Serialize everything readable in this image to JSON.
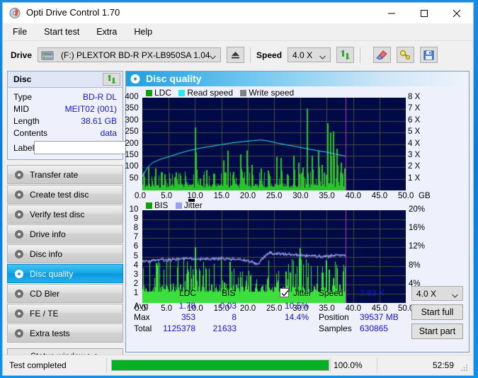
{
  "window": {
    "title": "Opti Drive Control 1.70",
    "icon": "disc-icon",
    "minimize": "—",
    "maximize": "□",
    "close": "✕"
  },
  "menu": {
    "items": [
      {
        "label": "File"
      },
      {
        "label": "Start test"
      },
      {
        "label": "Extra"
      },
      {
        "label": "Help"
      }
    ]
  },
  "toolbar": {
    "drive_label": "Drive",
    "drive_value": "(F:)  PLEXTOR BD-R  PX-LB950SA 1.04",
    "eject_icon": "eject-icon",
    "speed_label": "Speed",
    "speed_value": "4.0 X",
    "refresh_icon": "refresh-icon",
    "eraser_icon": "eraser-icon",
    "tools_icon": "tools-icon",
    "save_icon": "save-icon"
  },
  "sidebar": {
    "disc_panel": {
      "title": "Disc",
      "refresh_icon": "refresh-icon",
      "rows": [
        {
          "key": "Type",
          "value": "BD-R DL"
        },
        {
          "key": "MID",
          "value": "MEIT02 (001)"
        },
        {
          "key": "Length",
          "value": "38.61 GB"
        },
        {
          "key": "Contents",
          "value": "data"
        }
      ],
      "label_key": "Label",
      "label_value": "",
      "label_placeholder": "",
      "disc_icon": "cd-icon"
    },
    "nav": [
      {
        "label": "Transfer rate",
        "icon": "disc-icon",
        "active": false
      },
      {
        "label": "Create test disc",
        "icon": "disc-write-icon",
        "active": false
      },
      {
        "label": "Verify test disc",
        "icon": "disc-verify-icon",
        "active": false
      },
      {
        "label": "Drive info",
        "icon": "disc-info-icon",
        "active": false
      },
      {
        "label": "Disc info",
        "icon": "disc-info-icon",
        "active": false
      },
      {
        "label": "Disc quality",
        "icon": "disc-quality-icon",
        "active": true
      },
      {
        "label": "CD Bler",
        "icon": "disc-bler-icon",
        "active": false
      },
      {
        "label": "FE / TE",
        "icon": "disc-fete-icon",
        "active": false
      },
      {
        "label": "Extra tests",
        "icon": "disc-extra-icon",
        "active": false
      }
    ],
    "status_window_button": "Status window > >"
  },
  "panel": {
    "title": "Disc quality",
    "icon": "disc-quality-icon"
  },
  "chart_data": [
    {
      "id": "top-chart",
      "type": "line",
      "title": "LDC / Read speed",
      "legend": [
        {
          "label": "LDC",
          "color": "#07a407"
        },
        {
          "label": "Read speed",
          "color": "#2ee6f0"
        },
        {
          "label": "Write speed",
          "color": "#808080"
        }
      ],
      "xlabel": "GB",
      "x_ticks": [
        "0.0",
        "5.0",
        "10.0",
        "15.0",
        "20.0",
        "25.0",
        "30.0",
        "35.0",
        "40.0",
        "45.0",
        "50.0"
      ],
      "xlim": [
        0,
        50
      ],
      "ylabel_left": "LDC",
      "y_ticks_left": [
        "50",
        "100",
        "150",
        "200",
        "250",
        "300",
        "350",
        "400"
      ],
      "ylim_left": [
        0,
        400
      ],
      "ylabel_right": "Speed",
      "y_ticks_right": [
        "1 X",
        "2 X",
        "3 X",
        "4 X",
        "5 X",
        "6 X",
        "7 X",
        "8 X"
      ],
      "ylim_right": [
        0,
        8
      ],
      "data_end_gb": 38.61,
      "grid": true,
      "bg": "#000a46",
      "series": [
        {
          "name": "Read speed",
          "color": "#2ee6f0",
          "x": [
            0.0,
            1.0,
            2.0,
            3.5,
            5.0,
            7.0,
            9.0,
            11.0,
            13.0,
            15.0,
            17.0,
            19.0,
            21.0,
            22.5,
            23.5,
            24.3,
            25.0,
            26.0,
            27.5,
            29.0,
            31.0,
            33.0,
            35.0,
            36.5,
            38.0,
            38.61
          ],
          "y": [
            1.2,
            2.0,
            2.4,
            2.7,
            2.9,
            3.2,
            3.45,
            3.65,
            3.8,
            3.95,
            4.1,
            4.2,
            4.3,
            4.35,
            4.3,
            4.22,
            4.15,
            4.05,
            3.92,
            3.8,
            3.62,
            3.45,
            3.3,
            3.15,
            3.0,
            2.95
          ]
        },
        {
          "name": "LDC",
          "color": "#2bc32b",
          "note": "dense spike series, baseline ~20-40, major spikes listed",
          "baseline": 25,
          "spikes": [
            {
              "x": 1.1,
              "y": 100
            },
            {
              "x": 2.4,
              "y": 95
            },
            {
              "x": 4.2,
              "y": 70
            },
            {
              "x": 6.3,
              "y": 78
            },
            {
              "x": 8.0,
              "y": 62
            },
            {
              "x": 9.9,
              "y": 272
            },
            {
              "x": 10.1,
              "y": 150
            },
            {
              "x": 12.1,
              "y": 88
            },
            {
              "x": 13.6,
              "y": 72
            },
            {
              "x": 15.3,
              "y": 130
            },
            {
              "x": 16.1,
              "y": 172
            },
            {
              "x": 17.2,
              "y": 80
            },
            {
              "x": 18.6,
              "y": 155
            },
            {
              "x": 19.8,
              "y": 172
            },
            {
              "x": 20.7,
              "y": 110
            },
            {
              "x": 22.5,
              "y": 95
            },
            {
              "x": 23.8,
              "y": 86
            },
            {
              "x": 25.4,
              "y": 145
            },
            {
              "x": 26.2,
              "y": 140
            },
            {
              "x": 27.4,
              "y": 70
            },
            {
              "x": 28.6,
              "y": 150
            },
            {
              "x": 29.6,
              "y": 120
            },
            {
              "x": 30.4,
              "y": 98
            },
            {
              "x": 31.2,
              "y": 353
            },
            {
              "x": 32.1,
              "y": 150
            },
            {
              "x": 33.3,
              "y": 170
            },
            {
              "x": 34.0,
              "y": 110
            },
            {
              "x": 35.1,
              "y": 290
            },
            {
              "x": 35.6,
              "y": 250
            },
            {
              "x": 36.1,
              "y": 255
            },
            {
              "x": 36.8,
              "y": 180
            },
            {
              "x": 37.6,
              "y": 120
            },
            {
              "x": 38.3,
              "y": 95
            }
          ]
        }
      ]
    },
    {
      "id": "bottom-chart",
      "type": "line",
      "title": "BIS / Jitter",
      "legend": [
        {
          "label": "BIS",
          "color": "#07a407"
        },
        {
          "label": "Jitter",
          "color": "#9aa0ee"
        }
      ],
      "xlabel": "GB",
      "x_ticks": [
        "0.0",
        "5.0",
        "10.0",
        "15.0",
        "20.0",
        "25.0",
        "30.0",
        "35.0",
        "40.0",
        "45.0",
        "50.0"
      ],
      "xlim": [
        0,
        50
      ],
      "ylabel_left": "BIS",
      "y_ticks_left": [
        "1",
        "2",
        "3",
        "4",
        "5",
        "6",
        "7",
        "8",
        "9",
        "10"
      ],
      "ylim_left": [
        0,
        10
      ],
      "ylabel_right": "Jitter",
      "y_ticks_right": [
        "4%",
        "8%",
        "12%",
        "16%",
        "20%"
      ],
      "ylim_right": [
        0,
        20
      ],
      "data_end_gb": 38.61,
      "grid": true,
      "bg": "#000a46",
      "series": [
        {
          "name": "Jitter",
          "color": "#9aa0ee",
          "avg_pct": 10.5,
          "max_pct": 14.4,
          "x": [
            0.0,
            1.5,
            3.0,
            5.0,
            7.0,
            9.0,
            11.0,
            13.0,
            15.0,
            17.0,
            19.0,
            21.0,
            22.0,
            23.0,
            24.0,
            25.0,
            27.0,
            29.0,
            31.0,
            33.0,
            35.0,
            37.0,
            38.6
          ],
          "y": [
            9.2,
            9.0,
            9.4,
            9.3,
            9.5,
            9.6,
            9.4,
            9.5,
            9.6,
            9.4,
            9.3,
            8.8,
            8.4,
            9.8,
            10.9,
            10.6,
            10.5,
            10.4,
            10.2,
            10.1,
            10.0,
            10.4,
            10.3
          ]
        },
        {
          "name": "BIS",
          "color": "#2bc32b",
          "baseline": 1.0,
          "spikes": [
            {
              "x": 2.6,
              "y": 4.3
            },
            {
              "x": 5.2,
              "y": 2.0
            },
            {
              "x": 7.1,
              "y": 2.0
            },
            {
              "x": 9.9,
              "y": 6.0
            },
            {
              "x": 11.4,
              "y": 2.0
            },
            {
              "x": 13.0,
              "y": 2.0
            },
            {
              "x": 15.4,
              "y": 2.2
            },
            {
              "x": 17.8,
              "y": 2.0
            },
            {
              "x": 19.6,
              "y": 2.4
            },
            {
              "x": 21.5,
              "y": 2.1
            },
            {
              "x": 23.8,
              "y": 2.8
            },
            {
              "x": 25.6,
              "y": 2.2
            },
            {
              "x": 27.1,
              "y": 3.4
            },
            {
              "x": 28.0,
              "y": 3.3
            },
            {
              "x": 29.9,
              "y": 5.9
            },
            {
              "x": 31.3,
              "y": 2.6
            },
            {
              "x": 33.1,
              "y": 2.1
            },
            {
              "x": 34.8,
              "y": 4.6
            },
            {
              "x": 35.4,
              "y": 3.6
            },
            {
              "x": 36.2,
              "y": 2.7
            },
            {
              "x": 37.4,
              "y": 2.0
            }
          ]
        }
      ]
    }
  ],
  "stats": {
    "col_headers": [
      "LDC",
      "BIS"
    ],
    "row_labels": [
      "Avg",
      "Max",
      "Total"
    ],
    "ldc": {
      "avg": "1.78",
      "max": "353",
      "total": "1125378"
    },
    "bis": {
      "avg": "0.03",
      "max": "8",
      "total": "21633"
    },
    "jitter": {
      "checkbox_label": "Jitter",
      "checked": true,
      "avg": "10.5%",
      "max": "14.4%"
    },
    "speed_label": "Speed",
    "speed_value": "2.83 X",
    "position_label": "Position",
    "position_value": "39537 MB",
    "samples_label": "Samples",
    "samples_value": "630865",
    "speed_select": "4.0 X",
    "start_full_button": "Start full",
    "start_part_button": "Start part"
  },
  "statusbar": {
    "text": "Test completed",
    "progress_pct": 100.0,
    "progress_label": "100.0%",
    "elapsed": "52:59"
  },
  "colors": {
    "accent": "#0a7ad6",
    "chart_bg": "#000a46",
    "ldc_green": "#2bc32b",
    "read_speed_cyan": "#2ee6f0",
    "jitter_purple": "#9aa0ee",
    "value_blue": "#1414d2",
    "progress_green": "#06b025",
    "marker_magenta": "#c030c0"
  }
}
